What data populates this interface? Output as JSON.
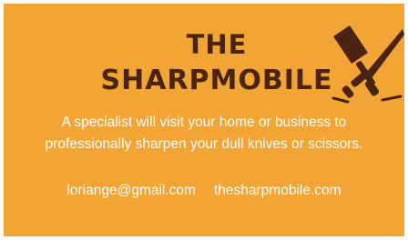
{
  "brand": {
    "title_line1": "THE",
    "title_line2": "SHARPMOBILE",
    "logo_icon": "crossed-knives-icon"
  },
  "tagline": {
    "line1": "A specialist will visit your home or business to",
    "line2": "professionally sharpen your dull knives or scissors."
  },
  "contact": {
    "email": "loriange@gmail.com",
    "website": "thesharpmobile.com"
  },
  "colors": {
    "background": "#f2a534",
    "title": "#4a2410",
    "text": "#ffffff"
  }
}
